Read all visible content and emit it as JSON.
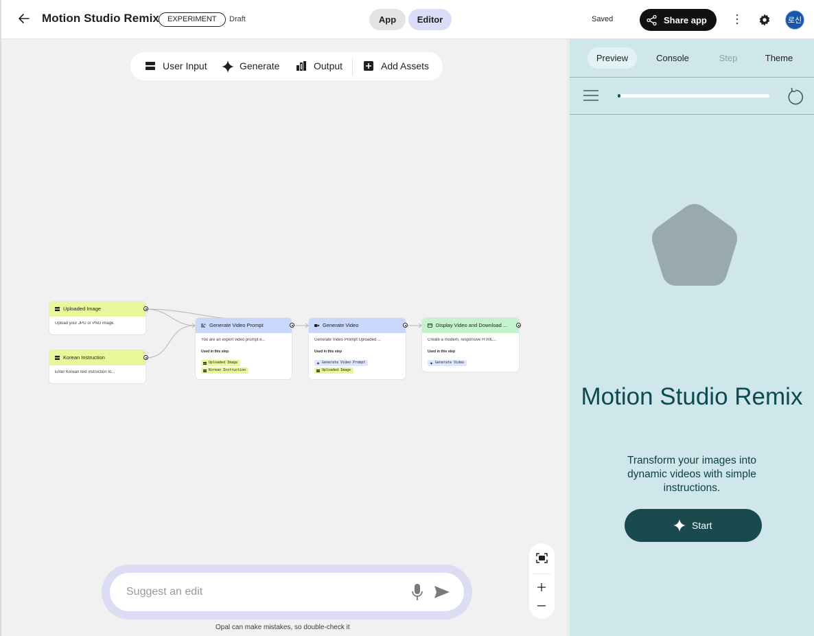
{
  "header": {
    "title": "Motion Studio Remix",
    "badge": "EXPERIMENT",
    "status": "Draft",
    "modes": [
      "App",
      "Editor"
    ],
    "active_mode": "Editor",
    "save_state": "Saved",
    "share_label": "Share app",
    "avatar_text": "로신"
  },
  "toolbar": {
    "items": [
      {
        "label": "User Input",
        "icon": "user-input-icon"
      },
      {
        "label": "Generate",
        "icon": "sparkle-icon"
      },
      {
        "label": "Output",
        "icon": "output-icon"
      },
      {
        "label": "Add Assets",
        "icon": "add-box-icon"
      }
    ]
  },
  "nodes": {
    "uploaded_image": {
      "title": "Uploaded Image",
      "body": "Upload your JPG or PNG image."
    },
    "korean_instruction": {
      "title": "Korean Instruction",
      "body": "Enter Korean text instruction fo..."
    },
    "generate_prompt": {
      "title": "Generate Video Prompt",
      "body": "You are an expert video prompt e...",
      "used_label": "Used in this step",
      "chips": [
        "Uploaded Image",
        "Korean Instruction"
      ]
    },
    "generate_video": {
      "title": "Generate Video",
      "body": "Generate Video Prompt Uploaded ...",
      "used_label": "Used in this step",
      "chips": [
        "Generate Video Prompt",
        "Uploaded Image"
      ]
    },
    "display_video": {
      "title": "Display Video and Download ...",
      "body": "Create a modern, responsive HTML...",
      "used_label": "Used in this step",
      "chips": [
        "Generate Video"
      ]
    }
  },
  "suggest": {
    "placeholder": "Suggest an edit"
  },
  "disclaimer": "Opal can make mistakes, so double-check it",
  "panel": {
    "tabs": [
      "Preview",
      "Console",
      "Step",
      "Theme"
    ],
    "active_tab": "Preview",
    "progress": 0.01,
    "hero_title": "Motion Studio Remix",
    "hero_subtitle": "Transform your images into dynamic videos with simple instructions.",
    "start_label": "Start"
  },
  "colors": {
    "input_node": "#e9f79a",
    "generate_node": "#c9d7fb",
    "output_node": "#c4f2cc",
    "panel_bg": "#cfe6eb",
    "start_button": "#1a4a4e",
    "hero_text": "#0b4a50"
  }
}
